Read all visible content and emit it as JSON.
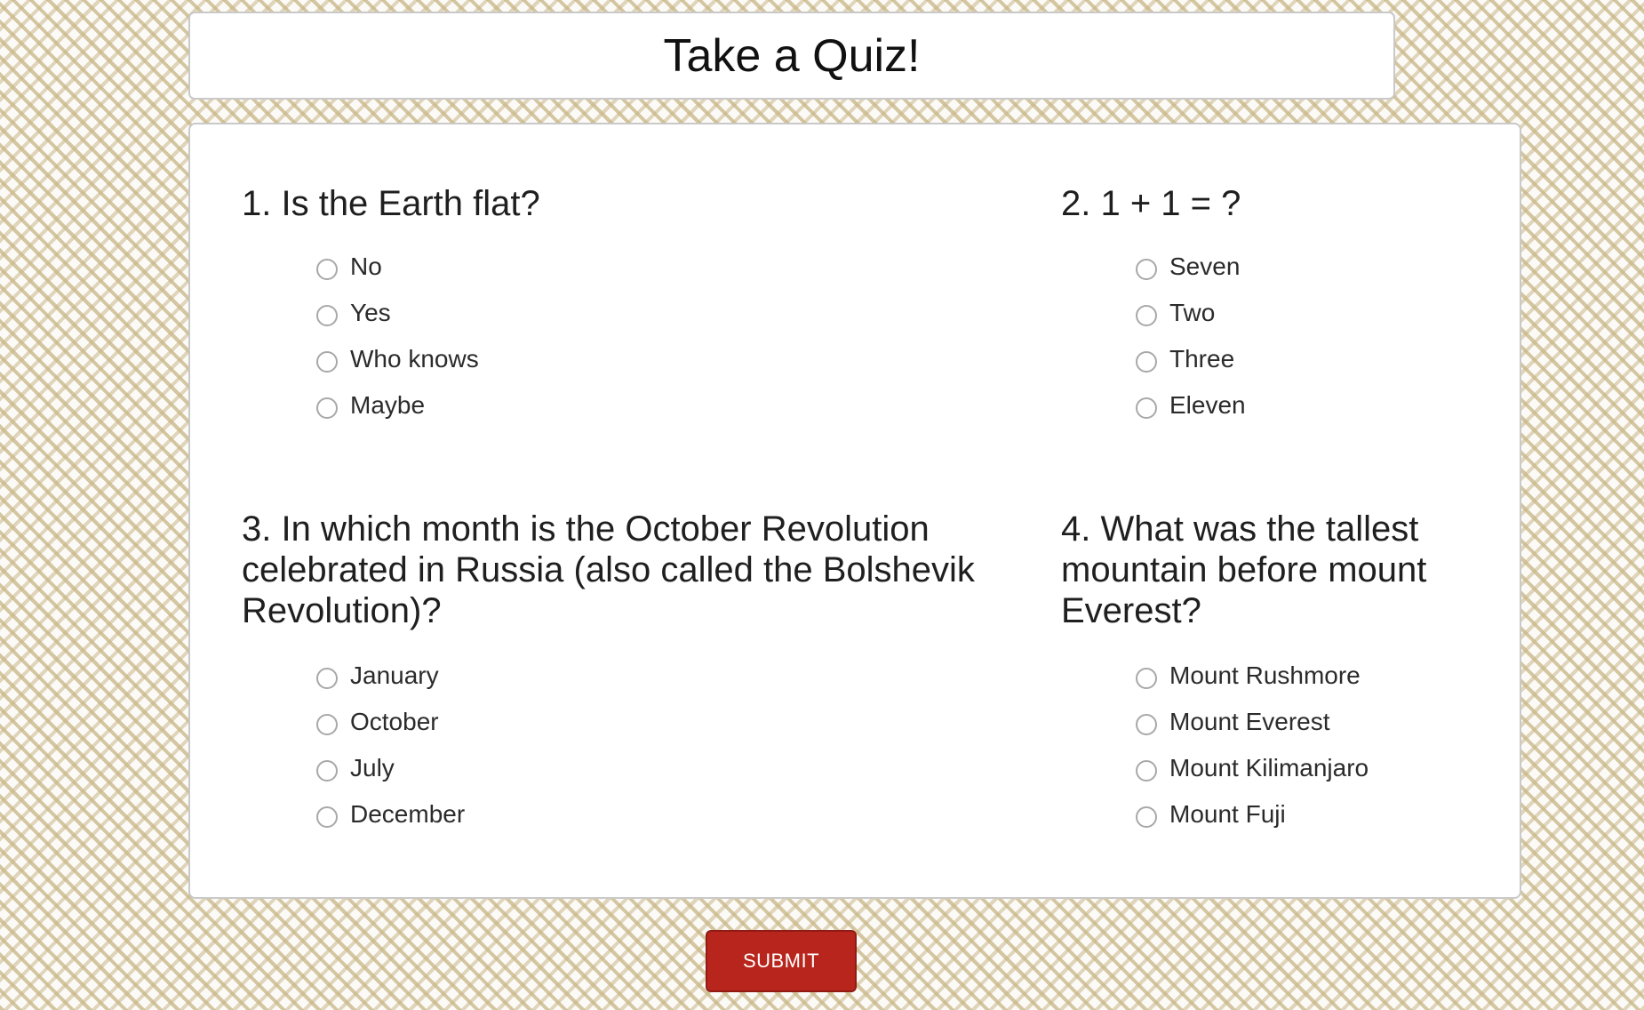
{
  "header": {
    "title": "Take a Quiz!"
  },
  "questions": [
    {
      "text": "1. Is the Earth flat?",
      "options": [
        "No",
        "Yes",
        "Who knows",
        "Maybe"
      ]
    },
    {
      "text": "2. 1 + 1 = ?",
      "options": [
        "Seven",
        "Two",
        "Three",
        "Eleven"
      ]
    },
    {
      "text": "3. In which month is the October Revolution celebrated in Russia (also called the Bolshevik Revolution)?",
      "options": [
        "January",
        "October",
        "July",
        "December"
      ]
    },
    {
      "text": "4. What was the tallest mountain before mount Everest?",
      "options": [
        "Mount Rushmore",
        "Mount Everest",
        "Mount Kilimanjaro",
        "Mount Fuji"
      ]
    }
  ],
  "submit": {
    "label": "SUBMIT"
  },
  "colors": {
    "submit_bg": "#b8251c",
    "pattern": "#c9b788"
  }
}
